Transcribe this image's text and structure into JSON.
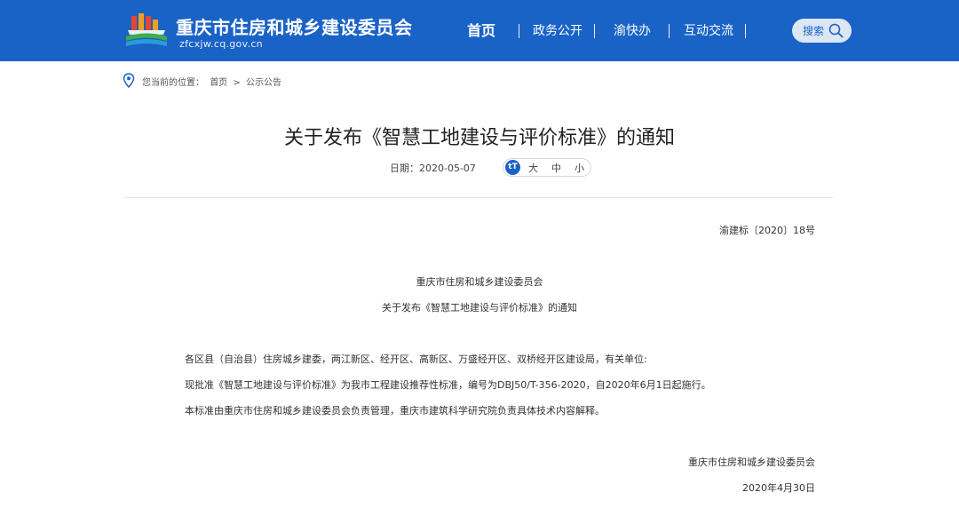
{
  "header": {
    "site_title": "重庆市住房和城乡建设委员会",
    "site_domain": "zfcxjw.cq.gov.cn",
    "nav": [
      {
        "label": "首页",
        "active": true
      },
      {
        "label": "政务公开",
        "active": false
      },
      {
        "label": "渝快办",
        "active": false
      },
      {
        "label": "互动交流",
        "active": false
      }
    ],
    "search_label": "搜索",
    "brand_color": "#1a63c6"
  },
  "breadcrumb": {
    "prefix": "您当前的位置：",
    "items": [
      "首页",
      ">",
      "公示公告"
    ]
  },
  "article": {
    "title": "关于发布《智慧工地建设与评价标准》的通知",
    "date_label": "日期：",
    "date_value": "2020-05-07",
    "font_size_icon_text": "tT",
    "font_sizes": [
      "大",
      "中",
      "小"
    ]
  },
  "body": {
    "doc_number": "渝建标〔2020〕18号",
    "issuer": "重庆市住房和城乡建设委员会",
    "subject": "关于发布《智慧工地建设与评价标准》的通知",
    "addressee": "各区县（自治县）住房城乡建委，两江新区、经开区、高新区、万盛经开区、双桥经开区建设局，有关单位:",
    "paragraph_1": "现批准《智慧工地建设与评价标准》为我市工程建设推荐性标准，编号为DBJ50/T-356-2020，自2020年6月1日起施行。",
    "paragraph_2": "本标准由重庆市住房和城乡建设委员会负责管理，重庆市建筑科学研究院负责具体技术内容解释。",
    "signature": "重庆市住房和城乡建设委员会",
    "signature_date": "2020年4月30日"
  }
}
